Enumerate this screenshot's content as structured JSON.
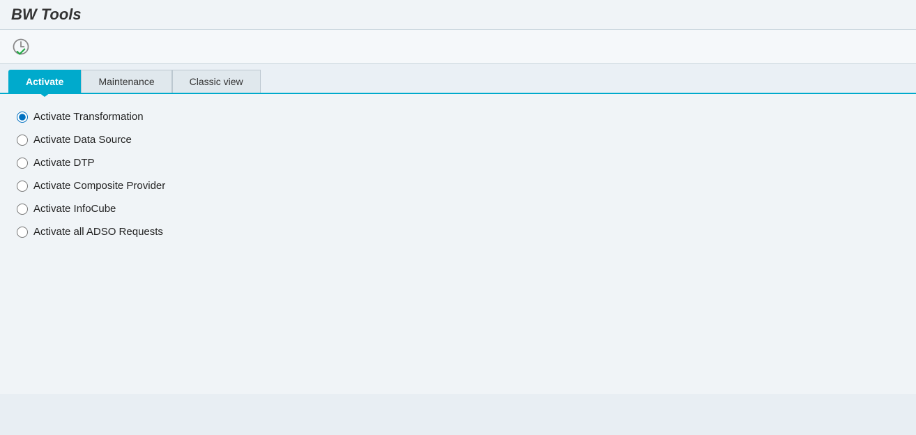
{
  "app": {
    "title": "BW Tools"
  },
  "tabs": [
    {
      "id": "activate",
      "label": "Activate",
      "active": true
    },
    {
      "id": "maintenance",
      "label": "Maintenance",
      "active": false
    },
    {
      "id": "classic-view",
      "label": "Classic view",
      "active": false
    }
  ],
  "radio_options": [
    {
      "id": "opt-transformation",
      "label": "Activate Transformation",
      "checked": true
    },
    {
      "id": "opt-datasource",
      "label": "Activate Data Source",
      "checked": false
    },
    {
      "id": "opt-dtp",
      "label": "Activate DTP",
      "checked": false
    },
    {
      "id": "opt-composite",
      "label": "Activate Composite Provider",
      "checked": false
    },
    {
      "id": "opt-infocube",
      "label": "Activate InfoCube",
      "checked": false
    },
    {
      "id": "opt-adso",
      "label": "Activate all ADSO Requests",
      "checked": false
    }
  ]
}
